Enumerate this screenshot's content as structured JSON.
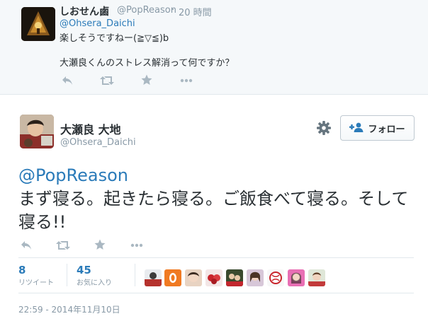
{
  "parent": {
    "name": "しおせん鹵",
    "handle": "@PopReason",
    "dot": "·",
    "time": "20 時間",
    "mention": "@Ohsera_Daichi",
    "line1": "楽しそうですねー(≧▽≦)b",
    "line2": "大瀬良くんのストレス解消って何ですか？"
  },
  "main": {
    "name": "大瀬良 大地",
    "handle": "@Ohsera_Daichi",
    "follow_label": "フォロー",
    "text_mention": "@PopReason",
    "text_body": "まず寝る。起きたら寝る。ご飯食べて寝る。そして寝る!!",
    "retweets": {
      "count": "8",
      "label": "リツイート"
    },
    "favorites": {
      "count": "45",
      "label": "お気に入り"
    },
    "timestamp": "22:59 - 2014年11月10日"
  },
  "icons": {
    "reply": "reply-icon",
    "retweet": "retweet-icon",
    "favorite": "star-icon",
    "more": "more-icon",
    "settings": "gear-icon",
    "follow": "add-user-icon"
  },
  "colors": {
    "link": "#2b7bb9",
    "muted": "#8899a6",
    "text": "#292f33",
    "parent_bg": "#f5f8fa",
    "icon": "#aab8c2"
  }
}
